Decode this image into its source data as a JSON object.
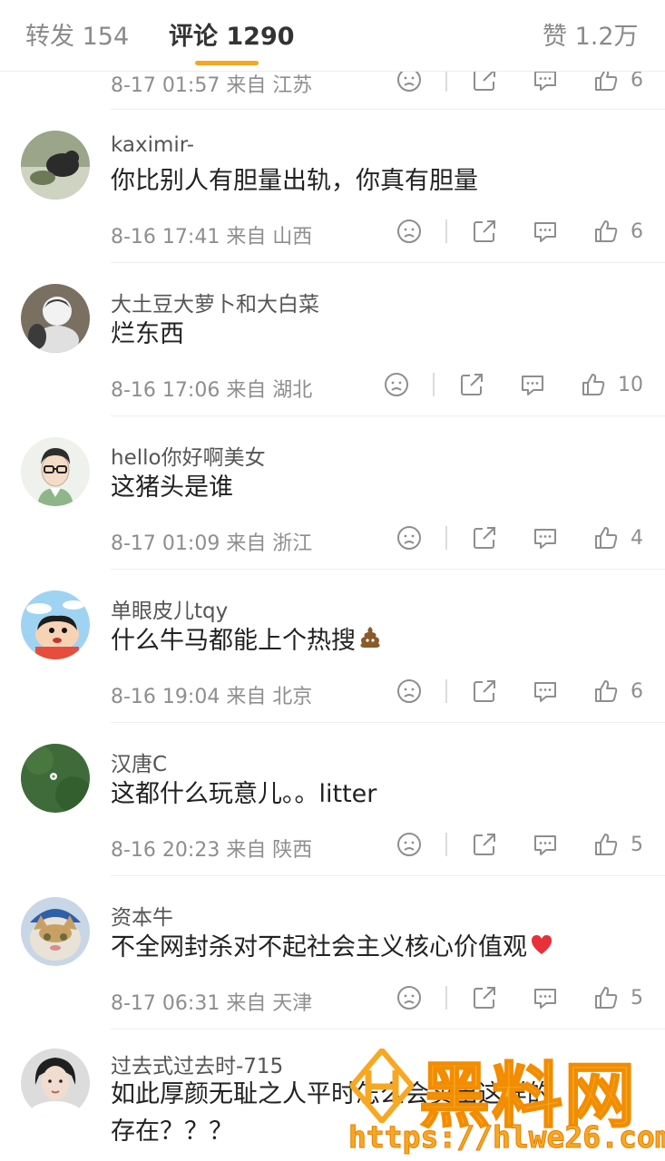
{
  "tabs": {
    "repost": "转发 154",
    "comments": "评论 1290",
    "likes": "赞 1.2万"
  },
  "partial": {
    "time": "8-17 01:57 来自 江苏",
    "likes": "6"
  },
  "comments": [
    {
      "user": "kaximir-",
      "text": "你比别人有胆量出轨，你真有胆量",
      "time": "8-16 17:41 来自 山西",
      "likes": "6"
    },
    {
      "user": "大土豆大萝卜和大白菜",
      "text": "烂东西",
      "time": "8-16 17:06 来自 湖北",
      "likes": "10"
    },
    {
      "user": "hello你好啊美女",
      "text": "这猪头是谁",
      "time": "8-17 01:09 来自 浙江",
      "likes": "4"
    },
    {
      "user": "单眼皮儿tqy",
      "text": "什么牛马都能上个热搜",
      "time": "8-16 19:04 来自 北京",
      "likes": "6"
    },
    {
      "user": "汉唐C",
      "text": "这都什么玩意儿。。litter",
      "time": "8-16 20:23 来自 陕西",
      "likes": "5"
    },
    {
      "user": "资本牛",
      "text": "不全网封杀对不起社会主义核心价值观",
      "time": "8-17 06:31 来自 天津",
      "likes": "5"
    },
    {
      "user": "过去式过去时-715",
      "text": "如此厚颜无耻之人平时怎么会卖出这样的",
      "text2": "存在？？？"
    }
  ],
  "watermark": {
    "brand": "黑料网",
    "url": "https://hlwe26.com"
  },
  "colors": {
    "accent": "#f5a623",
    "meta": "#8e8e8e",
    "divider": "#eeeeee"
  },
  "icons": [
    "dislike-face-icon",
    "share-icon",
    "comment-icon",
    "thumbs-up-icon",
    "poop-emoji",
    "heart-emoji"
  ]
}
